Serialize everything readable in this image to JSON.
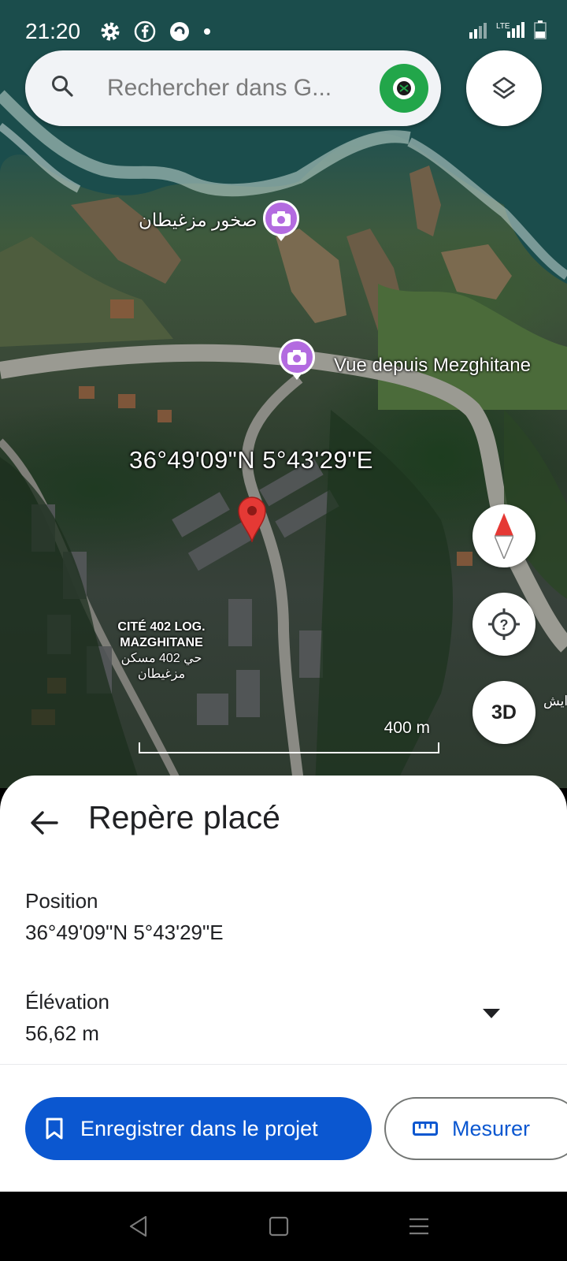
{
  "status_bar": {
    "time": "21:20",
    "left_icons": [
      "gear-icon",
      "facebook-icon",
      "app-icon",
      "dot-icon"
    ],
    "right_icons": [
      "signal-icon",
      "lte-icon",
      "signal-icon",
      "battery-icon"
    ]
  },
  "search": {
    "placeholder": "Rechercher dans G..."
  },
  "map": {
    "labels": {
      "rocks_ar": "صخور مزغيطان",
      "viewpoint": "Vue depuis Mezghitane",
      "coordinates": "36°49'09\"N 5°43'29\"E",
      "cite_line1": "CITÉ 402 LOG.",
      "cite_line2": "MAZGHITANE",
      "cite_ar1": "حي 402 مسكن",
      "cite_ar2": "مزغيطان",
      "edge_ar": "ايش"
    },
    "scale_label": "400 m",
    "buttons": {
      "threeD": "3D"
    }
  },
  "sheet": {
    "title": "Repère placé",
    "position_label": "Position",
    "position_value": "36°49'09\"N 5°43'29\"E",
    "elevation_label": "Élévation",
    "elevation_value": "56,62 m",
    "save_label": "Enregistrer dans le projet",
    "measure_label": "Mesurer"
  },
  "colors": {
    "accent": "#0b57d0",
    "pin": "#e53935",
    "photo_pin": "#b36be0",
    "avatar": "#22a64a"
  }
}
